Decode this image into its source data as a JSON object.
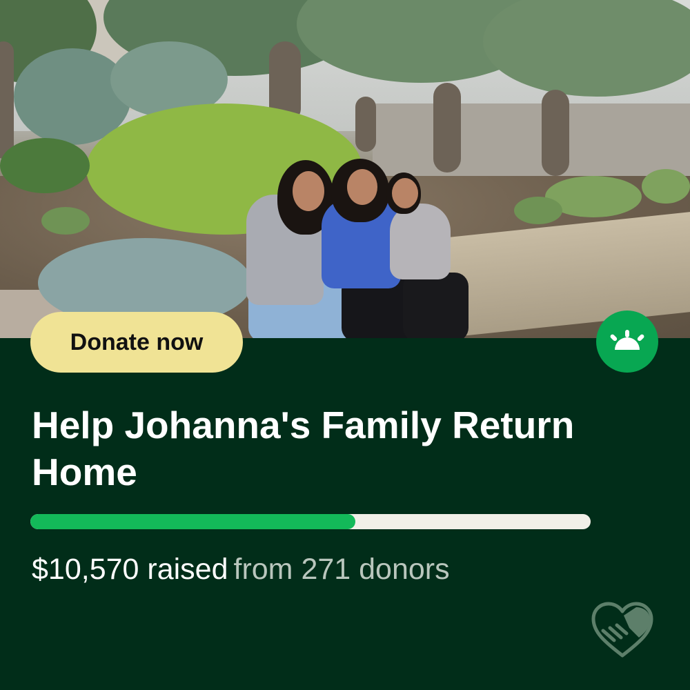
{
  "card": {
    "cta_label": "Donate now",
    "title": "Help Johanna's Family Return Home",
    "raised_text": "$10,570 raised",
    "donors_text": "from 271 donors",
    "progress_fraction": 0.58
  },
  "icons": {
    "brand_badge": "sunrise-icon",
    "footer_logo": "heart-handshake-icon"
  },
  "colors": {
    "background": "#012d19",
    "cta_background": "#f0e395",
    "accent_green": "#08a752",
    "progress_fill": "#13b959",
    "progress_track": "#f1efe8"
  }
}
